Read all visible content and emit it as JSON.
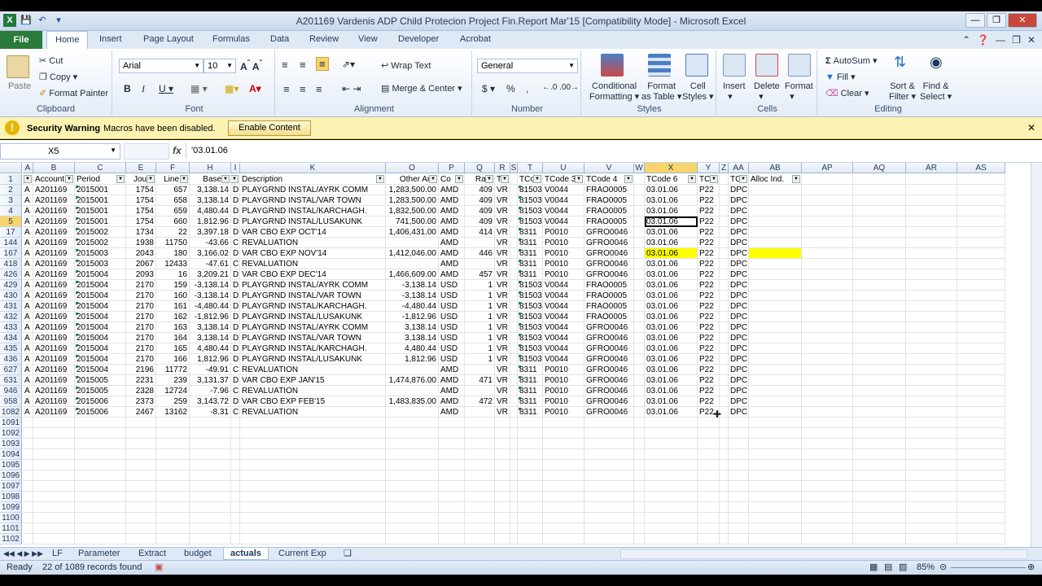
{
  "window": {
    "title": "A201169 Vardenis ADP Child Protecion Project Fin.Report Mar'15  [Compatibility Mode]  -  Microsoft Excel"
  },
  "ribbon_tabs": [
    "Home",
    "Insert",
    "Page Layout",
    "Formulas",
    "Data",
    "Review",
    "View",
    "Developer",
    "Acrobat"
  ],
  "file_tab": "File",
  "clipboard": {
    "paste": "Paste",
    "cut": "Cut",
    "copy": "Copy",
    "format_painter": "Format Painter",
    "label": "Clipboard"
  },
  "font": {
    "name": "Arial",
    "size": "10",
    "label": "Font"
  },
  "alignment": {
    "wrap": "Wrap Text",
    "merge": "Merge & Center",
    "label": "Alignment"
  },
  "number": {
    "format": "General",
    "label": "Number"
  },
  "styles": {
    "cond": "Conditional",
    "cond2": "Formatting",
    "fmt_table": "Format",
    "fmt_table2": "as Table",
    "cell_styles": "Cell",
    "cell_styles2": "Styles",
    "label": "Styles"
  },
  "cells": {
    "insert": "Insert",
    "delete": "Delete",
    "format": "Format",
    "label": "Cells"
  },
  "editing": {
    "autosum": "AutoSum",
    "fill": "Fill",
    "clear": "Clear",
    "sort": "Sort &",
    "sort2": "Filter",
    "find": "Find &",
    "find2": "Select",
    "label": "Editing"
  },
  "security": {
    "title": "Security Warning",
    "message": "Macros have been disabled.",
    "button": "Enable Content"
  },
  "formula_bar": {
    "name_box": "X5",
    "fx": "fx",
    "value": "'03.01.06"
  },
  "columns": [
    "A",
    "B",
    "C",
    "E",
    "F",
    "H",
    "I",
    "K",
    "O",
    "P",
    "Q",
    "R",
    "S",
    "T",
    "U",
    "V",
    "W",
    "X",
    "Y",
    "Z",
    "AA",
    "AB",
    "AP",
    "AQ",
    "AR",
    "AS"
  ],
  "header_row": {
    "num": "1",
    "cells": [
      "L",
      "Account",
      "Period",
      "Journ",
      "Line N",
      "Base A",
      "I",
      "Description",
      "Other Amt",
      "Co",
      "Rate",
      "TC",
      "",
      "TCo",
      "TCode 3",
      "TCode 4",
      "",
      "TCode 6",
      "TCo",
      "",
      "TC",
      "Alloc Ind.",
      "",
      "",
      "",
      ""
    ]
  },
  "rows": [
    {
      "n": "2",
      "c": [
        "A",
        "A201169",
        "2015001",
        "1754",
        "657",
        "3,138.14",
        "D",
        "PLAYGRND INSTAL/AYRK COMM",
        "1,283,500.00",
        "AMD",
        "409",
        "VR",
        "",
        "81503",
        "V0044",
        "FRAO0005",
        "",
        "03.01.06",
        "P22",
        "",
        "DPC",
        "",
        "",
        "",
        "",
        ""
      ]
    },
    {
      "n": "3",
      "c": [
        "A",
        "A201169",
        "2015001",
        "1754",
        "658",
        "3,138.14",
        "D",
        "PLAYGRND INSTAL/VAR TOWN",
        "1,283,500.00",
        "AMD",
        "409",
        "VR",
        "",
        "81503",
        "V0044",
        "FRAO0005",
        "",
        "03.01.06",
        "P22",
        "",
        "DPC",
        "",
        "",
        "",
        "",
        ""
      ]
    },
    {
      "n": "4",
      "c": [
        "A",
        "A201169",
        "2015001",
        "1754",
        "659",
        "4,480.44",
        "D",
        "PLAYGRND INSTAL/KARCHAGH.",
        "1,832,500.00",
        "AMD",
        "409",
        "VR",
        "",
        "81503",
        "V0044",
        "FRAO0005",
        "",
        "03.01.06",
        "P22",
        "",
        "DPC",
        "",
        "",
        "",
        "",
        ""
      ]
    },
    {
      "n": "5",
      "c": [
        "A",
        "A201169",
        "2015001",
        "1754",
        "660",
        "1,812.96",
        "D",
        "PLAYGRND INSTAL/LUSAKUNK",
        "741,500.00",
        "AMD",
        "409",
        "VR",
        "",
        "81503",
        "V0044",
        "FRAO0005",
        "",
        "03.01.06",
        "P22",
        "",
        "DPC",
        "",
        "",
        "",
        "",
        ""
      ]
    },
    {
      "n": "17",
      "c": [
        "A",
        "A201169",
        "2015002",
        "1734",
        "22",
        "3,397.18",
        "D",
        "VAR CBO EXP OCT'14",
        "1,406,431.00",
        "AMD",
        "414",
        "VR",
        "",
        "8311",
        "P0010",
        "GFRO0046",
        "",
        "03.01.06",
        "P22",
        "",
        "DPC",
        "",
        "",
        "",
        "",
        ""
      ]
    },
    {
      "n": "144",
      "c": [
        "A",
        "A201169",
        "2015002",
        "1938",
        "11750",
        "-43.66",
        "C",
        "REVALUATION",
        "",
        "AMD",
        "",
        "VR",
        "",
        "8311",
        "P0010",
        "GFRO0046",
        "",
        "03.01.06",
        "P22",
        "",
        "DPC",
        "",
        "",
        "",
        "",
        ""
      ]
    },
    {
      "n": "167",
      "c": [
        "A",
        "A201169",
        "2015003",
        "2043",
        "180",
        "3,166.02",
        "D",
        "VAR CBO EXP NOV'14",
        "1,412,046.00",
        "AMD",
        "446",
        "VR",
        "",
        "8311",
        "P0010",
        "GFRO0046",
        "",
        "03.01.06",
        "P22",
        "",
        "DPC",
        "",
        "",
        "",
        "",
        ""
      ]
    },
    {
      "n": "418",
      "c": [
        "A",
        "A201169",
        "2015003",
        "2067",
        "12433",
        "-47.61",
        "C",
        "REVALUATION",
        "",
        "AMD",
        "",
        "VR",
        "",
        "8311",
        "P0010",
        "GFRO0046",
        "",
        "03.01.06",
        "P22",
        "",
        "DPC",
        "",
        "",
        "",
        "",
        ""
      ]
    },
    {
      "n": "426",
      "c": [
        "A",
        "A201169",
        "2015004",
        "2093",
        "16",
        "3,209.21",
        "D",
        "VAR CBO EXP DEC'14",
        "1,466,609.00",
        "AMD",
        "457",
        "VR",
        "",
        "8311",
        "P0010",
        "GFRO0046",
        "",
        "03.01.06",
        "P22",
        "",
        "DPC",
        "",
        "",
        "",
        "",
        ""
      ]
    },
    {
      "n": "429",
      "c": [
        "A",
        "A201169",
        "2015004",
        "2170",
        "159",
        "-3,138.14",
        "D",
        "PLAYGRND INSTAL/AYRK COMM",
        "-3,138.14",
        "USD",
        "1",
        "VR",
        "",
        "81503",
        "V0044",
        "FRAO0005",
        "",
        "03.01.06",
        "P22",
        "",
        "DPC",
        "",
        "",
        "",
        "",
        ""
      ]
    },
    {
      "n": "430",
      "c": [
        "A",
        "A201169",
        "2015004",
        "2170",
        "160",
        "-3,138.14",
        "D",
        "PLAYGRND INSTAL/VAR TOWN",
        "-3,138.14",
        "USD",
        "1",
        "VR",
        "",
        "81503",
        "V0044",
        "FRAO0005",
        "",
        "03.01.06",
        "P22",
        "",
        "DPC",
        "",
        "",
        "",
        "",
        ""
      ]
    },
    {
      "n": "431",
      "c": [
        "A",
        "A201169",
        "2015004",
        "2170",
        "161",
        "-4,480.44",
        "D",
        "PLAYGRND INSTAL/KARCHAGH.",
        "-4,480.44",
        "USD",
        "1",
        "VR",
        "",
        "81503",
        "V0044",
        "FRAO0005",
        "",
        "03.01.06",
        "P22",
        "",
        "DPC",
        "",
        "",
        "",
        "",
        ""
      ]
    },
    {
      "n": "432",
      "c": [
        "A",
        "A201169",
        "2015004",
        "2170",
        "162",
        "-1,812.96",
        "D",
        "PLAYGRND INSTAL/LUSAKUNK",
        "-1,812.96",
        "USD",
        "1",
        "VR",
        "",
        "81503",
        "V0044",
        "FRAO0005",
        "",
        "03.01.06",
        "P22",
        "",
        "DPC",
        "",
        "",
        "",
        "",
        ""
      ]
    },
    {
      "n": "433",
      "c": [
        "A",
        "A201169",
        "2015004",
        "2170",
        "163",
        "3,138.14",
        "D",
        "PLAYGRND INSTAL/AYRK COMM",
        "3,138.14",
        "USD",
        "1",
        "VR",
        "",
        "81503",
        "V0044",
        "GFRO0046",
        "",
        "03.01.06",
        "P22",
        "",
        "DPC",
        "",
        "",
        "",
        "",
        ""
      ]
    },
    {
      "n": "434",
      "c": [
        "A",
        "A201169",
        "2015004",
        "2170",
        "164",
        "3,138.14",
        "D",
        "PLAYGRND INSTAL/VAR TOWN",
        "3,138.14",
        "USD",
        "1",
        "VR",
        "",
        "81503",
        "V0044",
        "GFRO0046",
        "",
        "03.01.06",
        "P22",
        "",
        "DPC",
        "",
        "",
        "",
        "",
        ""
      ]
    },
    {
      "n": "435",
      "c": [
        "A",
        "A201169",
        "2015004",
        "2170",
        "165",
        "4,480.44",
        "D",
        "PLAYGRND INSTAL/KARCHAGH.",
        "4,480.44",
        "USD",
        "1",
        "VR",
        "",
        "81503",
        "V0044",
        "GFRO0046",
        "",
        "03.01.06",
        "P22",
        "",
        "DPC",
        "",
        "",
        "",
        "",
        ""
      ]
    },
    {
      "n": "436",
      "c": [
        "A",
        "A201169",
        "2015004",
        "2170",
        "166",
        "1,812.96",
        "D",
        "PLAYGRND INSTAL/LUSAKUNK",
        "1,812.96",
        "USD",
        "1",
        "VR",
        "",
        "81503",
        "V0044",
        "GFRO0046",
        "",
        "03.01.06",
        "P22",
        "",
        "DPC",
        "",
        "",
        "",
        "",
        ""
      ]
    },
    {
      "n": "627",
      "c": [
        "A",
        "A201169",
        "2015004",
        "2196",
        "11772",
        "-49.91",
        "C",
        "REVALUATION",
        "",
        "AMD",
        "",
        "VR",
        "",
        "8311",
        "P0010",
        "GFRO0046",
        "",
        "03.01.06",
        "P22",
        "",
        "DPC",
        "",
        "",
        "",
        "",
        ""
      ]
    },
    {
      "n": "631",
      "c": [
        "A",
        "A201169",
        "2015005",
        "2231",
        "239",
        "3,131.37",
        "D",
        "VAR CBO EXP JAN'15",
        "1,474,876.00",
        "AMD",
        "471",
        "VR",
        "",
        "8311",
        "P0010",
        "GFRO0046",
        "",
        "03.01.06",
        "P22",
        "",
        "DPC",
        "",
        "",
        "",
        "",
        ""
      ]
    },
    {
      "n": "946",
      "c": [
        "A",
        "A201169",
        "2015005",
        "2328",
        "12724",
        "-7.96",
        "C",
        "REVALUATION",
        "",
        "AMD",
        "",
        "VR",
        "",
        "8311",
        "P0010",
        "GFRO0046",
        "",
        "03.01.06",
        "P22",
        "",
        "DPC",
        "",
        "",
        "",
        "",
        ""
      ]
    },
    {
      "n": "958",
      "c": [
        "A",
        "A201169",
        "2015006",
        "2373",
        "259",
        "3,143.72",
        "D",
        "VAR CBO EXP FEB'15",
        "1,483,835.00",
        "AMD",
        "472",
        "VR",
        "",
        "8311",
        "P0010",
        "GFRO0046",
        "",
        "03.01.06",
        "P22",
        "",
        "DPC",
        "",
        "",
        "",
        "",
        ""
      ]
    },
    {
      "n": "1082",
      "c": [
        "A",
        "A201169",
        "2015006",
        "2467",
        "13162",
        "-8.31",
        "C",
        "REVALUATION",
        "",
        "AMD",
        "",
        "VR",
        "",
        "8311",
        "P0010",
        "GFRO0046",
        "",
        "03.01.06",
        "P22",
        "",
        "DPC",
        "",
        "",
        "",
        "",
        ""
      ]
    }
  ],
  "empty_rows": [
    "1091",
    "1092",
    "1093",
    "1094",
    "1095",
    "1096",
    "1097",
    "1098",
    "1099",
    "1100",
    "1101",
    "1102"
  ],
  "sheet_tabs": [
    "LF",
    "Parameter",
    "Extract",
    "budget",
    "actuals",
    "Current Exp"
  ],
  "status": {
    "ready": "Ready",
    "records": "22 of 1089 records found",
    "zoom": "85%"
  },
  "colors": {
    "selection": "#f8d46c",
    "highlight": "#ffff00"
  }
}
